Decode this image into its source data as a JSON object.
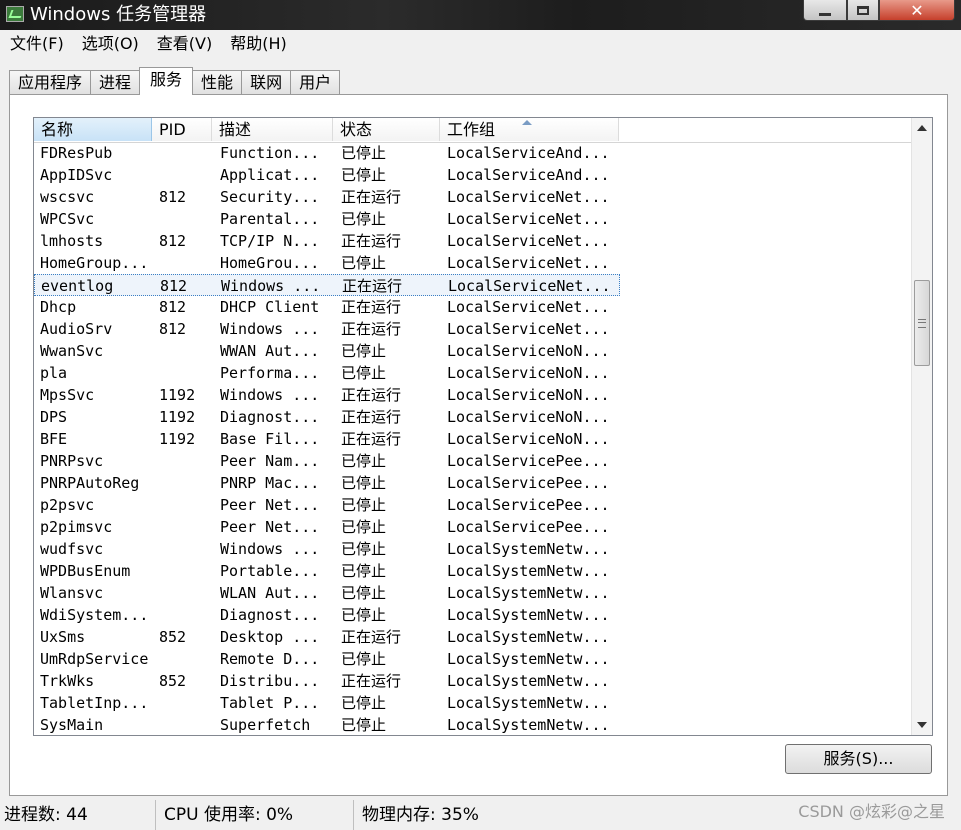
{
  "window": {
    "title": "Windows 任务管理器",
    "controls": {
      "minimize": "—",
      "close": "✕"
    }
  },
  "menu": [
    "文件(F)",
    "选项(O)",
    "查看(V)",
    "帮助(H)"
  ],
  "tabs": [
    "应用程序",
    "进程",
    "服务",
    "性能",
    "联网",
    "用户"
  ],
  "active_tab": 2,
  "columns": {
    "name": "名称",
    "pid": "PID",
    "desc": "描述",
    "status": "状态",
    "group": "工作组"
  },
  "sort_column": "group",
  "services": [
    {
      "name": "FDResPub",
      "pid": "",
      "desc": "Function...",
      "status": "已停止",
      "group": "LocalServiceAnd..."
    },
    {
      "name": "AppIDSvc",
      "pid": "",
      "desc": "Applicat...",
      "status": "已停止",
      "group": "LocalServiceAnd..."
    },
    {
      "name": "wscsvc",
      "pid": "812",
      "desc": "Security...",
      "status": "正在运行",
      "group": "LocalServiceNet..."
    },
    {
      "name": "WPCSvc",
      "pid": "",
      "desc": "Parental...",
      "status": "已停止",
      "group": "LocalServiceNet..."
    },
    {
      "name": "lmhosts",
      "pid": "812",
      "desc": "TCP/IP N...",
      "status": "正在运行",
      "group": "LocalServiceNet..."
    },
    {
      "name": "HomeGroup...",
      "pid": "",
      "desc": "HomeGrou...",
      "status": "已停止",
      "group": "LocalServiceNet..."
    },
    {
      "name": "eventlog",
      "pid": "812",
      "desc": "Windows ...",
      "status": "正在运行",
      "group": "LocalServiceNet...",
      "selected": true
    },
    {
      "name": "Dhcp",
      "pid": "812",
      "desc": "DHCP Client",
      "status": "正在运行",
      "group": "LocalServiceNet..."
    },
    {
      "name": "AudioSrv",
      "pid": "812",
      "desc": "Windows ...",
      "status": "正在运行",
      "group": "LocalServiceNet..."
    },
    {
      "name": "WwanSvc",
      "pid": "",
      "desc": "WWAN Aut...",
      "status": "已停止",
      "group": "LocalServiceNoN..."
    },
    {
      "name": "pla",
      "pid": "",
      "desc": "Performa...",
      "status": "已停止",
      "group": "LocalServiceNoN..."
    },
    {
      "name": "MpsSvc",
      "pid": "1192",
      "desc": "Windows ...",
      "status": "正在运行",
      "group": "LocalServiceNoN..."
    },
    {
      "name": "DPS",
      "pid": "1192",
      "desc": "Diagnost...",
      "status": "正在运行",
      "group": "LocalServiceNoN..."
    },
    {
      "name": "BFE",
      "pid": "1192",
      "desc": "Base Fil...",
      "status": "正在运行",
      "group": "LocalServiceNoN..."
    },
    {
      "name": "PNRPsvc",
      "pid": "",
      "desc": "Peer Nam...",
      "status": "已停止",
      "group": "LocalServicePee..."
    },
    {
      "name": "PNRPAutoReg",
      "pid": "",
      "desc": "PNRP Mac...",
      "status": "已停止",
      "group": "LocalServicePee..."
    },
    {
      "name": "p2psvc",
      "pid": "",
      "desc": "Peer Net...",
      "status": "已停止",
      "group": "LocalServicePee..."
    },
    {
      "name": "p2pimsvc",
      "pid": "",
      "desc": "Peer Net...",
      "status": "已停止",
      "group": "LocalServicePee..."
    },
    {
      "name": "wudfsvc",
      "pid": "",
      "desc": "Windows ...",
      "status": "已停止",
      "group": "LocalSystemNetw..."
    },
    {
      "name": "WPDBusEnum",
      "pid": "",
      "desc": "Portable...",
      "status": "已停止",
      "group": "LocalSystemNetw..."
    },
    {
      "name": "Wlansvc",
      "pid": "",
      "desc": "WLAN Aut...",
      "status": "已停止",
      "group": "LocalSystemNetw..."
    },
    {
      "name": "WdiSystem...",
      "pid": "",
      "desc": "Diagnost...",
      "status": "已停止",
      "group": "LocalSystemNetw..."
    },
    {
      "name": "UxSms",
      "pid": "852",
      "desc": "Desktop ...",
      "status": "正在运行",
      "group": "LocalSystemNetw..."
    },
    {
      "name": "UmRdpService",
      "pid": "",
      "desc": "Remote D...",
      "status": "已停止",
      "group": "LocalSystemNetw..."
    },
    {
      "name": "TrkWks",
      "pid": "852",
      "desc": "Distribu...",
      "status": "正在运行",
      "group": "LocalSystemNetw..."
    },
    {
      "name": "TabletInp...",
      "pid": "",
      "desc": "Tablet P...",
      "status": "已停止",
      "group": "LocalSystemNetw..."
    },
    {
      "name": "SysMain",
      "pid": "",
      "desc": "Superfetch",
      "status": "已停止",
      "group": "LocalSystemNetw..."
    }
  ],
  "services_button": "服务(S)...",
  "statusbar": {
    "processes": "进程数: 44",
    "cpu": "CPU 使用率: 0%",
    "memory": "物理内存: 35%"
  },
  "watermark": "CSDN @炫彩@之星",
  "icons": {
    "app": "task-manager-icon",
    "scroll_up": "chevron-up-icon",
    "scroll_down": "chevron-down-icon",
    "sort": "sort-ascending-icon"
  }
}
